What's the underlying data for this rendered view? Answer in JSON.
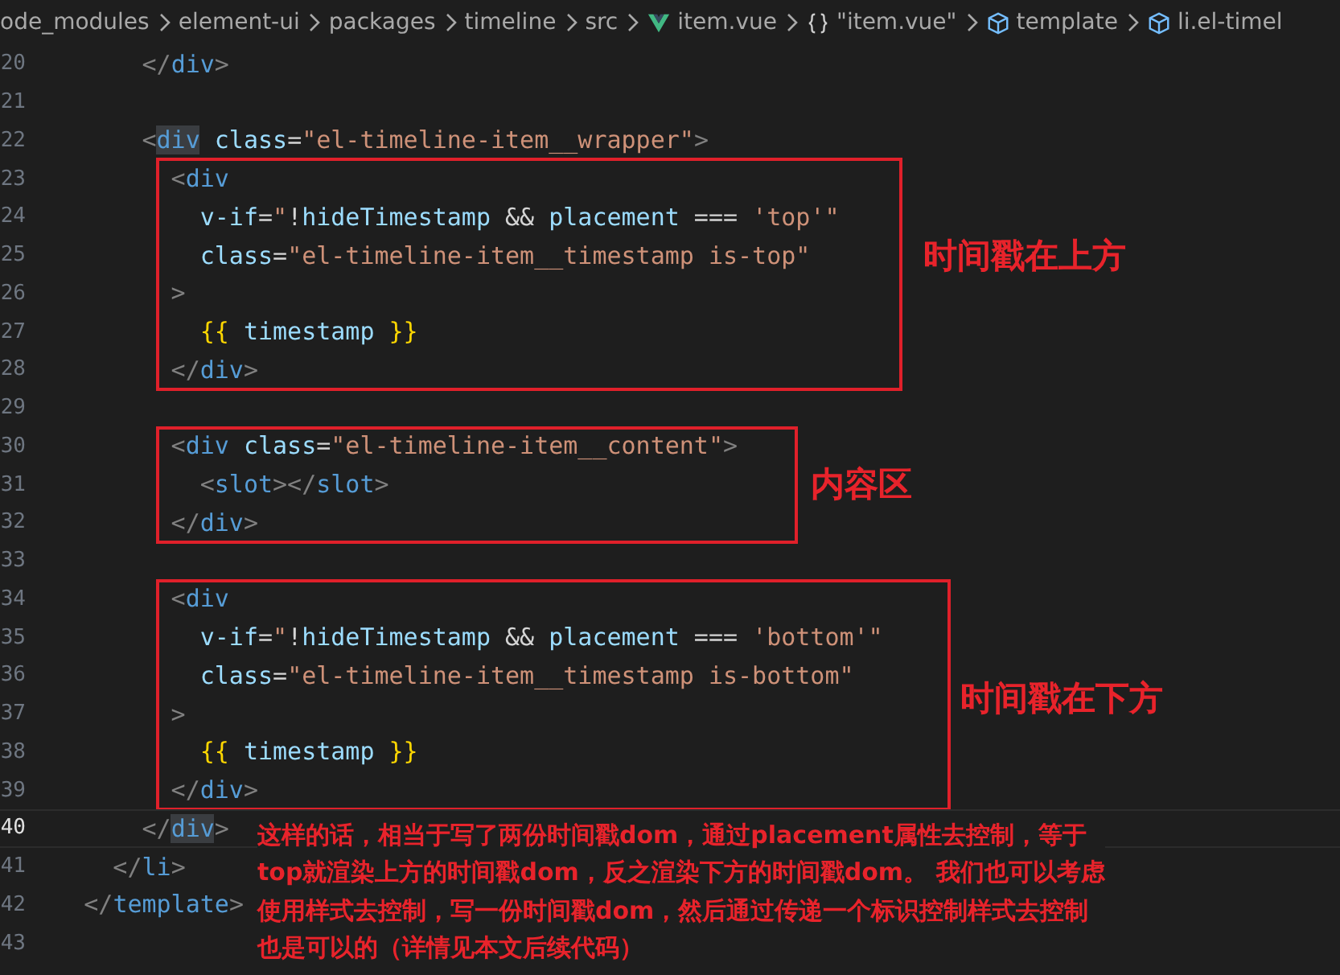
{
  "breadcrumb": [
    {
      "label": "ode_modules"
    },
    {
      "label": "element-ui"
    },
    {
      "label": "packages"
    },
    {
      "label": "timeline"
    },
    {
      "label": "src"
    },
    {
      "label": "item.vue",
      "kind": "vue"
    },
    {
      "label": "\"item.vue\"",
      "kind": "braces"
    },
    {
      "label": "template",
      "kind": "cube"
    },
    {
      "label": "li.el-timel",
      "kind": "cube"
    }
  ],
  "segments": [
    {
      "lines": [
        {
          "number": "20",
          "current": false,
          "tokens": [
            {
              "kind": "p",
              "text": "        </"
            },
            {
              "kind": "tag",
              "text": "div"
            },
            {
              "kind": "p",
              "text": ">"
            }
          ]
        },
        {
          "number": "21",
          "current": false
        },
        {
          "number": "22",
          "current": false,
          "tokens": [
            {
              "kind": "p",
              "text": "        <"
            },
            {
              "kind": "hl",
              "text": "div"
            },
            {
              "kind": "attr",
              "text": " class"
            },
            {
              "kind": "txt",
              "text": "="
            },
            {
              "kind": "str",
              "text": "\"el-timeline-item__wrapper\""
            },
            {
              "kind": "p",
              "text": ">"
            }
          ]
        }
      ]
    },
    {
      "label": "时间戳在上方",
      "lines": [
        {
          "number": "23",
          "current": false,
          "tokens": [
            {
              "kind": "p",
              "text": "          <"
            },
            {
              "kind": "tag",
              "text": "div"
            }
          ]
        },
        {
          "number": "24",
          "current": false,
          "tokens": [
            {
              "kind": "attr",
              "text": "            v-if"
            },
            {
              "kind": "txt",
              "text": "="
            },
            {
              "kind": "str",
              "text": "\""
            },
            {
              "kind": "txt",
              "text": "!"
            },
            {
              "kind": "var",
              "text": "hideTimestamp"
            },
            {
              "kind": "txt",
              "text": " && "
            },
            {
              "kind": "var",
              "text": "placement"
            },
            {
              "kind": "txt",
              "text": " === "
            },
            {
              "kind": "str",
              "text": "'top'\""
            }
          ]
        },
        {
          "number": "25",
          "current": false,
          "tokens": [
            {
              "kind": "attr",
              "text": "            class"
            },
            {
              "kind": "txt",
              "text": "="
            },
            {
              "kind": "str",
              "text": "\"el-timeline-item__timestamp is-top\""
            }
          ]
        },
        {
          "number": "26",
          "current": false,
          "tokens": [
            {
              "kind": "p",
              "text": "          >"
            }
          ]
        },
        {
          "number": "27",
          "current": false,
          "tokens": [
            {
              "kind": "mus",
              "text": "            {{"
            },
            {
              "kind": "var",
              "text": " timestamp "
            },
            {
              "kind": "mus",
              "text": "}}"
            }
          ]
        },
        {
          "number": "28",
          "current": false,
          "tokens": [
            {
              "kind": "p",
              "text": "          </"
            },
            {
              "kind": "tag",
              "text": "div"
            },
            {
              "kind": "p",
              "text": ">"
            }
          ]
        }
      ]
    },
    {
      "lines": [
        {
          "number": "29",
          "current": false
        }
      ]
    },
    {
      "label": "内容区",
      "lines": [
        {
          "number": "30",
          "current": false,
          "tokens": [
            {
              "kind": "p",
              "text": "          <"
            },
            {
              "kind": "tag",
              "text": "div"
            },
            {
              "kind": "attr",
              "text": " class"
            },
            {
              "kind": "txt",
              "text": "="
            },
            {
              "kind": "str",
              "text": "\"el-timeline-item__content\""
            },
            {
              "kind": "p",
              "text": ">"
            }
          ]
        },
        {
          "number": "31",
          "current": false,
          "tokens": [
            {
              "kind": "p",
              "text": "            <"
            },
            {
              "kind": "tag",
              "text": "slot"
            },
            {
              "kind": "p",
              "text": "></"
            },
            {
              "kind": "tag",
              "text": "slot"
            },
            {
              "kind": "p",
              "text": ">"
            }
          ]
        },
        {
          "number": "32",
          "current": false,
          "tokens": [
            {
              "kind": "p",
              "text": "          </"
            },
            {
              "kind": "tag",
              "text": "div"
            },
            {
              "kind": "p",
              "text": ">"
            }
          ]
        }
      ]
    },
    {
      "lines": [
        {
          "number": "33",
          "current": false
        }
      ]
    },
    {
      "label": "时间戳在下方",
      "lines": [
        {
          "number": "34",
          "current": false,
          "tokens": [
            {
              "kind": "p",
              "text": "          <"
            },
            {
              "kind": "tag",
              "text": "div"
            }
          ]
        },
        {
          "number": "35",
          "current": false,
          "tokens": [
            {
              "kind": "attr",
              "text": "            v-if"
            },
            {
              "kind": "txt",
              "text": "="
            },
            {
              "kind": "str",
              "text": "\""
            },
            {
              "kind": "txt",
              "text": "!"
            },
            {
              "kind": "var",
              "text": "hideTimestamp"
            },
            {
              "kind": "txt",
              "text": " && "
            },
            {
              "kind": "var",
              "text": "placement"
            },
            {
              "kind": "txt",
              "text": " === "
            },
            {
              "kind": "str",
              "text": "'bottom'\""
            }
          ]
        },
        {
          "number": "36",
          "current": false,
          "tokens": [
            {
              "kind": "attr",
              "text": "            class"
            },
            {
              "kind": "txt",
              "text": "="
            },
            {
              "kind": "str",
              "text": "\"el-timeline-item__timestamp is-bottom\""
            }
          ]
        },
        {
          "number": "37",
          "current": false,
          "tokens": [
            {
              "kind": "p",
              "text": "          >"
            }
          ]
        },
        {
          "number": "38",
          "current": false,
          "tokens": [
            {
              "kind": "mus",
              "text": "            {{"
            },
            {
              "kind": "var",
              "text": " timestamp "
            },
            {
              "kind": "mus",
              "text": "}}"
            }
          ]
        },
        {
          "number": "39",
          "current": false,
          "tokens": [
            {
              "kind": "p",
              "text": "          </"
            },
            {
              "kind": "tag",
              "text": "div"
            },
            {
              "kind": "p",
              "text": ">"
            }
          ]
        }
      ]
    },
    {
      "lines": [
        {
          "number": "40",
          "current": true,
          "tokens": [
            {
              "kind": "p",
              "text": "        </"
            },
            {
              "kind": "hl",
              "text": "div"
            },
            {
              "kind": "p",
              "text": ">"
            }
          ]
        },
        {
          "number": "41",
          "current": false,
          "tokens": [
            {
              "kind": "p",
              "text": "      </"
            },
            {
              "kind": "tag",
              "text": "li"
            },
            {
              "kind": "p",
              "text": ">"
            }
          ]
        },
        {
          "number": "42",
          "current": false,
          "tokens": [
            {
              "kind": "p",
              "text": "    </"
            },
            {
              "kind": "tag",
              "text": "template"
            },
            {
              "kind": "p",
              "text": ">"
            }
          ]
        },
        {
          "number": "43",
          "current": false
        }
      ]
    }
  ],
  "note": [
    "这样的话，相当于写了两份时间戳dom，通过placement属性去控制，等于",
    "top就渲染上方的时间戳dom，反之渲染下方的时间戳dom。  我们也可以考虑",
    "使用样式去控制，写一份时间戳dom，然后通过传递一个标识控制样式去控制",
    "也是可以的（详情见本文后续代码）"
  ]
}
